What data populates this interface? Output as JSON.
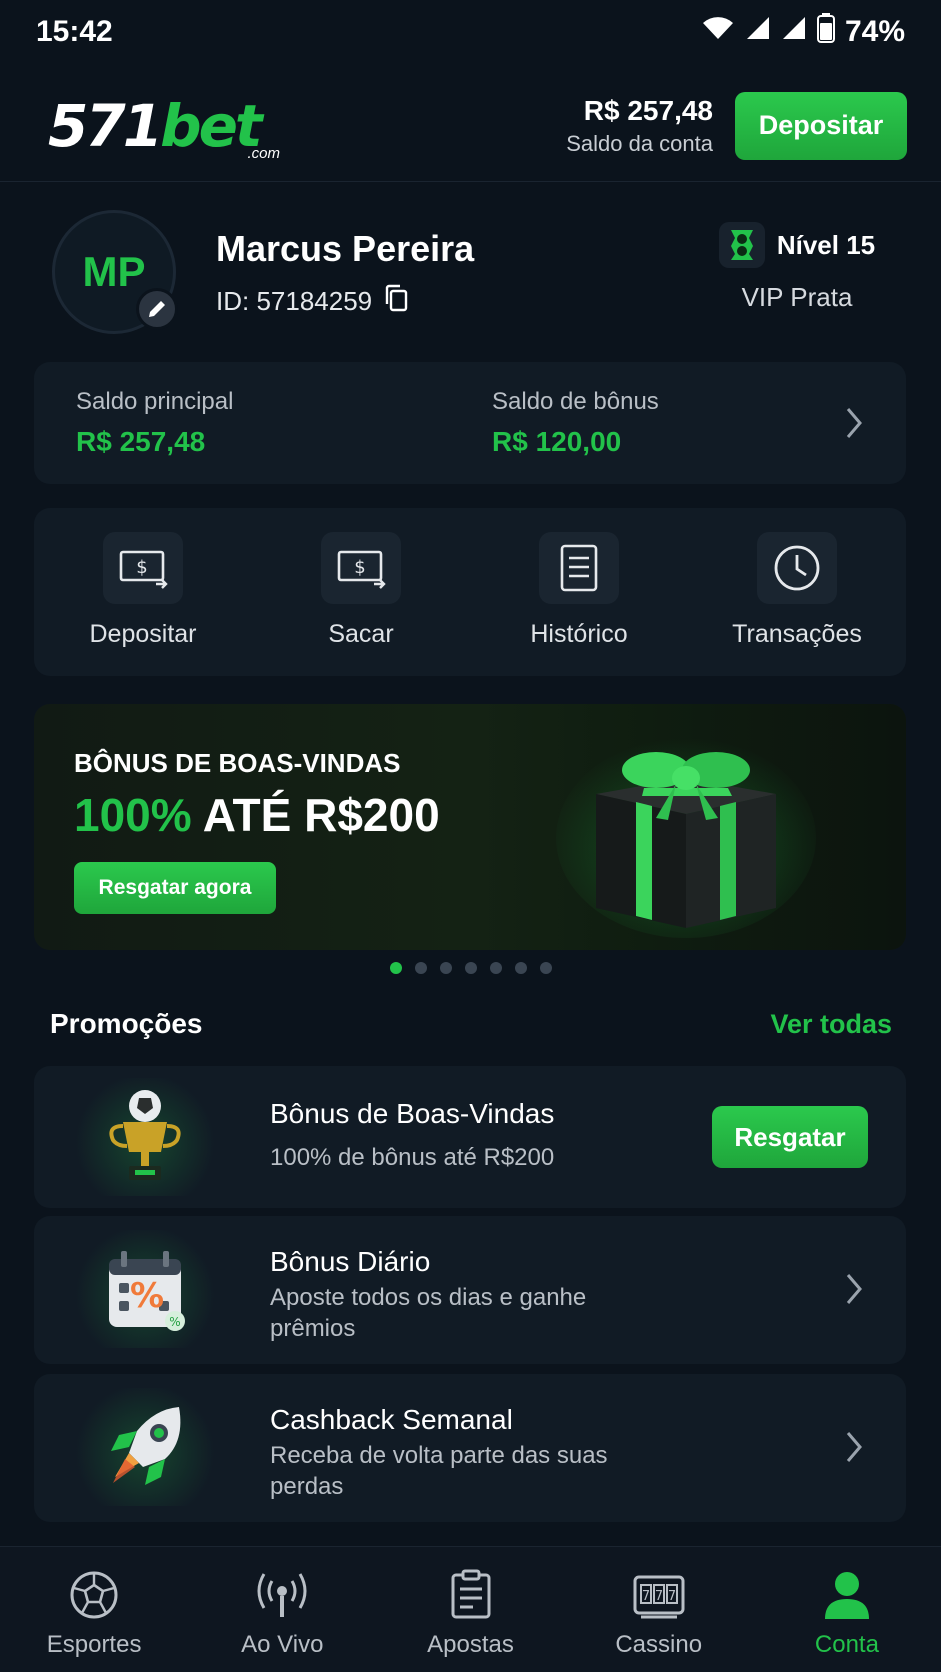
{
  "status_bar": {
    "time": "15:42",
    "battery": "74%"
  },
  "header": {
    "logo_main_a": "571",
    "logo_main_b": "bet",
    "logo_sub": ".com",
    "balance_amount": "R$ 257,48",
    "balance_label": "Saldo da conta",
    "deposit_button": "Depositar"
  },
  "profile": {
    "initials": "MP",
    "name": "Marcus Pereira",
    "id": "ID: 57184259",
    "level": "Nível 15",
    "tier": "VIP Prata"
  },
  "balances": {
    "main_label": "Saldo principal",
    "main_value": "R$ 257,48",
    "bonus_label": "Saldo de bônus",
    "bonus_value": "R$ 120,00"
  },
  "actions": [
    {
      "label": "Depositar",
      "icon": "deposit-icon"
    },
    {
      "label": "Sacar",
      "icon": "withdraw-icon"
    },
    {
      "label": "Histórico",
      "icon": "history-icon"
    },
    {
      "label": "Transações",
      "icon": "clock-icon"
    }
  ],
  "banner": {
    "subtitle": "BÔNUS DE BOAS-VINDAS",
    "title_green": "100%",
    "title_white": " ATÉ R$200",
    "button": "Resgatar agora",
    "slide_count": 7,
    "active_slide": 1
  },
  "promotions": {
    "title": "Promoções",
    "see_all": "Ver todas",
    "items": [
      {
        "name": "Bônus de Boas-Vindas",
        "desc": "100% de bônus até R$200",
        "button": "Resgatar",
        "icon": "trophy-icon"
      },
      {
        "name": "Bônus Diário",
        "desc": "Aposte todos os dias e ganhe prêmios",
        "icon": "calendar-percent-icon"
      },
      {
        "name": "Cashback Semanal",
        "desc": "Receba de volta parte das suas perdas",
        "icon": "rocket-icon"
      }
    ]
  },
  "bottom_nav": [
    {
      "label": "Esportes",
      "icon": "soccer-ball-icon"
    },
    {
      "label": "Ao Vivo",
      "icon": "live-broadcast-icon"
    },
    {
      "label": "Apostas",
      "icon": "betslip-icon"
    },
    {
      "label": "Cassino",
      "icon": "slot-machine-icon"
    },
    {
      "label": "Conta",
      "icon": "user-icon",
      "active": true
    }
  ],
  "colors": {
    "accent": "#22c24a",
    "background": "#0b131c",
    "card": "#111b25"
  }
}
